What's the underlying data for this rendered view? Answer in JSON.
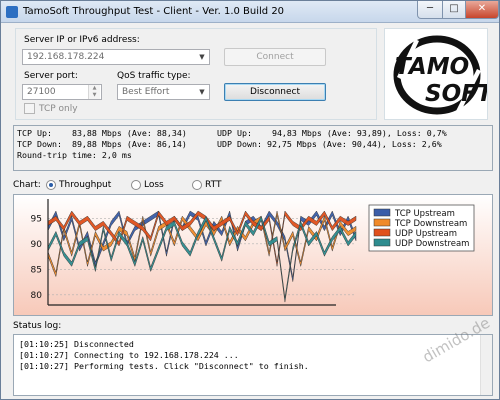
{
  "window": {
    "title": "TamoSoft Throughput Test - Client - Ver. 1.0 Build 20",
    "min_glyph": "─",
    "max_glyph": "□",
    "close_glyph": "✕"
  },
  "settings": {
    "server_label": "Server IP or IPv6  address:",
    "server_value": "192.168.178.224",
    "connect_label": "Connect",
    "port_label": "Server port:",
    "port_value": "27100",
    "qos_label": "QoS traffic type:",
    "qos_value": "Best Effort",
    "disconnect_label": "Disconnect",
    "tcp_only_label": "TCP only"
  },
  "logo": {
    "top_text": "TAMO",
    "bottom_text": "SOFT"
  },
  "stats": {
    "tcp_up": "TCP Up:    83,88 Mbps (Ave: 88,34)",
    "udp_up": "UDP Up:    94,83 Mbps (Ave: 93,89), Loss: 0,7%",
    "tcp_down": "TCP Down:  89,88 Mbps (Ave: 86,14)",
    "udp_down": "UDP Down: 92,75 Mbps (Ave: 90,44), Loss: 2,6%",
    "rtt": "Round-trip time: 2,0 ms"
  },
  "chart_selector": {
    "label": "Chart:",
    "options": [
      "Throughput",
      "Loss",
      "RTT"
    ],
    "selected": "Throughput"
  },
  "chart_data": {
    "type": "line",
    "title": "",
    "xlabel": "",
    "ylabel": "",
    "ylim": [
      78,
      98
    ],
    "yticks": [
      80,
      85,
      90,
      95
    ],
    "grid": true,
    "legend_position": "top-right",
    "x": [
      1,
      2,
      3,
      4,
      5,
      6,
      7,
      8,
      9,
      10,
      11,
      12,
      13,
      14,
      15,
      16,
      17,
      18,
      19,
      20,
      21,
      22,
      23,
      24,
      25,
      26,
      27,
      28,
      29,
      30,
      31,
      32,
      33,
      34,
      35,
      36,
      37,
      38,
      39,
      40
    ],
    "series": [
      {
        "name": "TCP Upstream",
        "color": "#3a5da8",
        "values": [
          93,
          96,
          91,
          95,
          89,
          92,
          86,
          90,
          94,
          96,
          90,
          93,
          94,
          95,
          96,
          88,
          95,
          93,
          96,
          95,
          90,
          94,
          92,
          96,
          89,
          94,
          95,
          93,
          96,
          94,
          91,
          83,
          95,
          94,
          96,
          93,
          96,
          92,
          95,
          91
        ]
      },
      {
        "name": "TCP Downstream",
        "color": "#f08a2a",
        "values": [
          88,
          84,
          93,
          88,
          94,
          86,
          92,
          89,
          90,
          93,
          92,
          87,
          95,
          88,
          93,
          94,
          90,
          95,
          93,
          91,
          94,
          92,
          95,
          90,
          93,
          91,
          94,
          95,
          88,
          96,
          89,
          92,
          86,
          93,
          91,
          95,
          89,
          94,
          92,
          93
        ]
      },
      {
        "name": "UDP Upstream",
        "color": "#e0501c",
        "values": [
          94,
          95,
          93,
          96,
          94,
          95,
          93,
          94,
          92,
          90,
          95,
          94,
          93,
          91,
          96,
          94,
          95,
          93,
          94,
          96,
          95,
          93,
          94,
          95,
          92,
          96,
          94,
          93,
          95,
          86,
          96,
          94,
          93,
          95,
          94,
          96,
          93,
          95,
          94,
          95
        ]
      },
      {
        "name": "UDP Downstream",
        "color": "#2e8c8f",
        "values": [
          89,
          92,
          88,
          86,
          90,
          91,
          85,
          93,
          87,
          92,
          90,
          86,
          91,
          85,
          89,
          93,
          94,
          90,
          88,
          92,
          95,
          91,
          87,
          93,
          90,
          94,
          92,
          95,
          90,
          91,
          79,
          89,
          94,
          90,
          92,
          88,
          91,
          93,
          90,
          92
        ]
      }
    ]
  },
  "status": {
    "label": "Status log:",
    "lines": [
      "[01:10:25] Disconnected",
      "[01:10:27] Connecting to 192.168.178.224 ...",
      "[01:10:27] Performing tests. Click \"Disconnect\" to finish."
    ]
  },
  "watermark": "dimido.de"
}
